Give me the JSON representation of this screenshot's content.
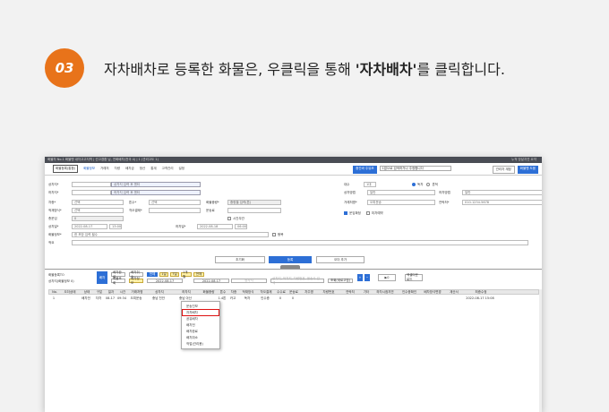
{
  "step": {
    "number": "03",
    "color": "#e8731a"
  },
  "instruction": {
    "before": "자차배차로 등록한 화물은, 우클릭을 통해 ",
    "bold": "'자차배차'",
    "after": "를 클릭합니다."
  },
  "app": {
    "title": "화물차 No.1 화물맨 내차고고지역 | 선고경환 님, 전화배차(전국 4) | 1 (관리고도 1)",
    "title_right": "누적 방달지연 요약",
    "menu_main": "화물등록(통합)",
    "menu": [
      "화물정보",
      "거래처",
      "차량",
      "배차금",
      "정산",
      "통계",
      "고객관리",
      "설정"
    ],
    "menu_active_index": 0,
    "header_button": "중간바 주유조",
    "header_search_placeholder": "1없으로 검색하거나 주정합니다",
    "header_user": "관리자 계정",
    "header_button2": "화물맨 도움"
  },
  "form": {
    "left": [
      {
        "label": "상차지*",
        "value": "상차지 입력 후 엔터"
      },
      {
        "label": "하차지*",
        "value": "하차지 입력 후 엔터"
      },
      {
        "label": "차종*",
        "value": "선택",
        "label2": "톤수*",
        "value2": "선택",
        "label3": "화물중량*",
        "value3": "중량을 입력(톤)"
      },
      {
        "label": "적재방식*",
        "value": "선택",
        "label2": "착오결제*",
        "value2": "",
        "label3": "운송료",
        "value3": ""
      },
      {
        "label": "총운임",
        "value": "0"
      },
      {
        "label": "상차일*",
        "value": "2022-08-17",
        "time": "13:00",
        "label2": "하차일*",
        "value2": "2022-08-18",
        "time2": "06:00",
        "check": "시간무관"
      },
      {
        "label": "화물정보*",
        "value": "한 포장 입력 필수",
        "check": "왕복"
      },
      {
        "label": "적요",
        "value": ""
      }
    ],
    "right": [
      {
        "label": "대수",
        "value": "1대",
        "radio1": "독차",
        "radio2": "혼적"
      },
      {
        "label": "상차방법",
        "value": "일반",
        "label2": "하차방법",
        "value2": "일반"
      },
      {
        "label": "거래처명*",
        "value": "오피운송",
        "label2": "연락처*",
        "value2": "010-1234-5678"
      },
      {
        "label": "",
        "check1": "운임확정",
        "check2": "미차예약"
      }
    ]
  },
  "action_buttons": {
    "reset": "초기화",
    "register": "등록",
    "more": "오더 추가"
  },
  "grid": {
    "label1": "화물등록TO",
    "label2": "상차지(화물정보 0)",
    "toggle": "배차",
    "btn1": "배차완료",
    "btn2": "배차취소",
    "btn3": "화물조회",
    "btn4": "배차정보",
    "chips": [
      "전체",
      "1일",
      "7일",
      "1개월",
      "전체"
    ],
    "date_from": "2022-08-17",
    "date_to": "2022-08-17",
    "search_placeholder": "상차지",
    "search2_placeholder": "상차지, 하차지, 차량번호, 운송사 검색",
    "search_btn": "조회(새로고침)",
    "count": "0",
    "excel_btn": "엑셀다운로드"
  },
  "table": {
    "columns": [
      "No.",
      "오더상태",
      "상태",
      "구분",
      "일자",
      "시간",
      "거래처명",
      "상차지",
      "하차지",
      "화물중량",
      "톤수",
      "차종",
      "적재방식",
      "착오결제",
      "수수료",
      "운송료",
      "차주명",
      "차량번호",
      "연락처",
      "기타",
      "하차시점지연",
      "인수증확인",
      "배차방식변경",
      "계산서",
      "최종수정"
    ],
    "rows": [
      [
        "1",
        "",
        "배차전",
        "자차",
        "08-17",
        "09:34",
        "오피운송",
        "충남 천안",
        "충남 아산",
        "",
        "1.4톤",
        "카고",
        "독차",
        "인수증",
        "0",
        "0",
        "",
        "",
        "",
        "",
        "",
        "",
        "",
        "",
        "2022-08-17 15:08"
      ]
    ]
  },
  "context_menu": {
    "items": [
      "운송진보",
      "자차배차",
      "공유배차",
      "배차전",
      "배차완료",
      "배차취소",
      "작업(관리용)"
    ],
    "highlight_index": 1,
    "highlight_color": "#dd1111"
  }
}
